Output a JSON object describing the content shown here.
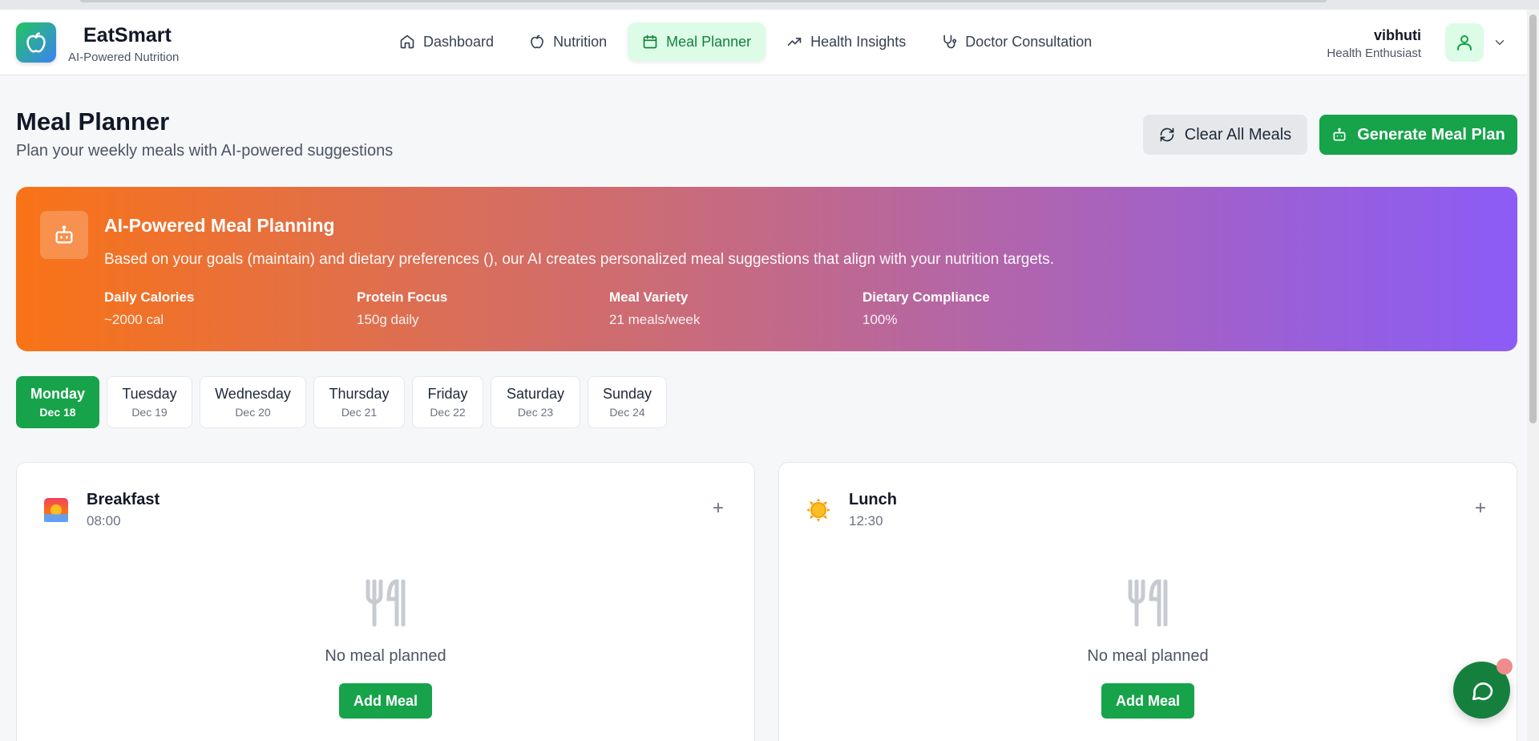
{
  "app": {
    "name": "EatSmart",
    "tagline": "AI-Powered Nutrition"
  },
  "nav": {
    "items": [
      {
        "label": "Dashboard",
        "icon": "home-icon",
        "active": false
      },
      {
        "label": "Nutrition",
        "icon": "apple-icon",
        "active": false
      },
      {
        "label": "Meal Planner",
        "icon": "calendar-icon",
        "active": true
      },
      {
        "label": "Health Insights",
        "icon": "trending-up-icon",
        "active": false
      },
      {
        "label": "Doctor Consultation",
        "icon": "stethoscope-icon",
        "active": false
      }
    ]
  },
  "user": {
    "name": "vibhuti",
    "role": "Health Enthusiast"
  },
  "page": {
    "title": "Meal Planner",
    "subtitle": "Plan your weekly meals with AI-powered suggestions",
    "clear_label": "Clear All Meals",
    "generate_label": "Generate Meal Plan"
  },
  "banner": {
    "title": "AI-Powered Meal Planning",
    "description": "Based on your goals (maintain) and dietary preferences (), our AI creates personalized meal suggestions that align with your nutrition targets.",
    "stats": [
      {
        "label": "Daily Calories",
        "value": "~2000 cal"
      },
      {
        "label": "Protein Focus",
        "value": "150g daily"
      },
      {
        "label": "Meal Variety",
        "value": "21 meals/week"
      },
      {
        "label": "Dietary Compliance",
        "value": "100%"
      }
    ]
  },
  "days": [
    {
      "name": "Monday",
      "date": "Dec 18",
      "active": true
    },
    {
      "name": "Tuesday",
      "date": "Dec 19",
      "active": false
    },
    {
      "name": "Wednesday",
      "date": "Dec 20",
      "active": false
    },
    {
      "name": "Thursday",
      "date": "Dec 21",
      "active": false
    },
    {
      "name": "Friday",
      "date": "Dec 22",
      "active": false
    },
    {
      "name": "Saturday",
      "date": "Dec 23",
      "active": false
    },
    {
      "name": "Sunday",
      "date": "Dec 24",
      "active": false
    }
  ],
  "meals": [
    {
      "name": "Breakfast",
      "time": "08:00",
      "icon": "sunrise-icon",
      "empty_text": "No meal planned",
      "add_label": "Add Meal",
      "plus": "+"
    },
    {
      "name": "Lunch",
      "time": "12:30",
      "icon": "sun-icon",
      "empty_text": "No meal planned",
      "add_label": "Add Meal",
      "plus": "+"
    }
  ],
  "colors": {
    "primary": "#16a34a",
    "active_nav_bg": "#dcfce7",
    "banner_start": "#f97316",
    "banner_end": "#8b5cf6"
  }
}
